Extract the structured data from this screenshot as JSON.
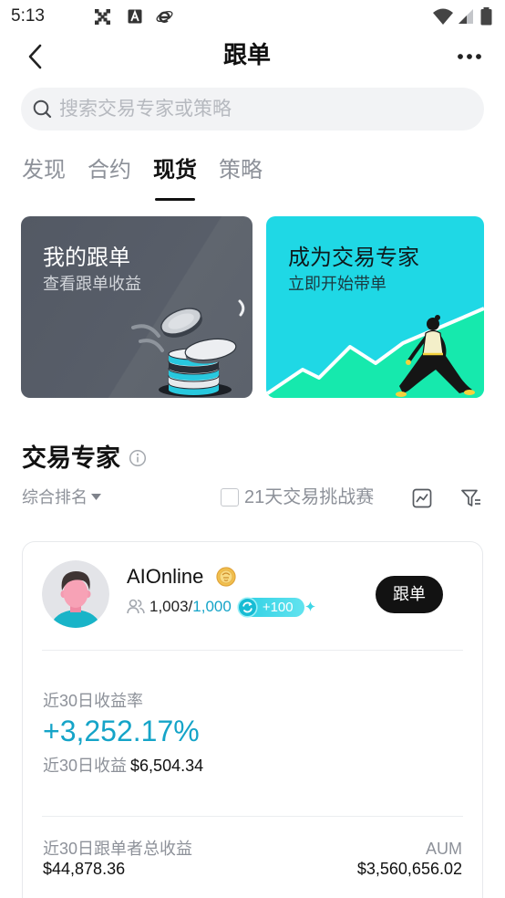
{
  "status_bar": {
    "time": "5:13",
    "notification_icons": [
      "grid-app-icon",
      "font-a-icon",
      "browser-e-icon"
    ],
    "system_icons": [
      "wifi-icon",
      "cell-signal-icon",
      "battery-icon"
    ]
  },
  "header": {
    "title": "跟单",
    "back_icon": "chevron-left-icon",
    "more_icon": "more-horizontal-icon"
  },
  "search": {
    "placeholder": "搜索交易专家或策略",
    "icon": "search-icon"
  },
  "tabs": [
    {
      "label": "发现",
      "active": false
    },
    {
      "label": "合约",
      "active": false
    },
    {
      "label": "现货",
      "active": true
    },
    {
      "label": "策略",
      "active": false
    }
  ],
  "promo_cards": [
    {
      "title": "我的跟单",
      "subtitle": "查看跟单收益",
      "illustration": "coins-stack-illustration"
    },
    {
      "title": "成为交易专家",
      "subtitle": "立即开始带单",
      "illustration": "rising-chart-person-illustration"
    }
  ],
  "section": {
    "title": "交易专家",
    "info_icon": "info-circle-icon"
  },
  "filters": {
    "sort_label": "综合排名",
    "challenge_label": "21天交易挑战赛",
    "challenge_checked": false,
    "chart_icon": "trend-chart-icon",
    "filter_icon": "filter-icon"
  },
  "traders": [
    {
      "name": "AIOnline",
      "level_badge_icon": "gold-medal-icon",
      "followers": {
        "current": "1,003",
        "separator": "/",
        "max": "1,000"
      },
      "bonus_badge": "+100",
      "follow_button": "跟单",
      "roi_label": "近30日收益率",
      "roi_value": "+3,252.17%",
      "pnl_label": "近30日收益",
      "pnl_value": "$6,504.34",
      "copier_pnl_label": "近30日跟单者总收益",
      "copier_pnl_value": "$44,878.36",
      "aum_label": "AUM",
      "aum_value": "$3,560,656.02"
    }
  ],
  "colors": {
    "accent": "#15a4c8",
    "text_primary": "#111111",
    "text_secondary": "#8d9199",
    "search_bg": "#f2f3f5",
    "promo_left_bg": "#585e69",
    "promo_right_bg": "#1fd8e5",
    "promo_right_mint": "#16e9ad",
    "follow_button_bg": "#121212"
  }
}
